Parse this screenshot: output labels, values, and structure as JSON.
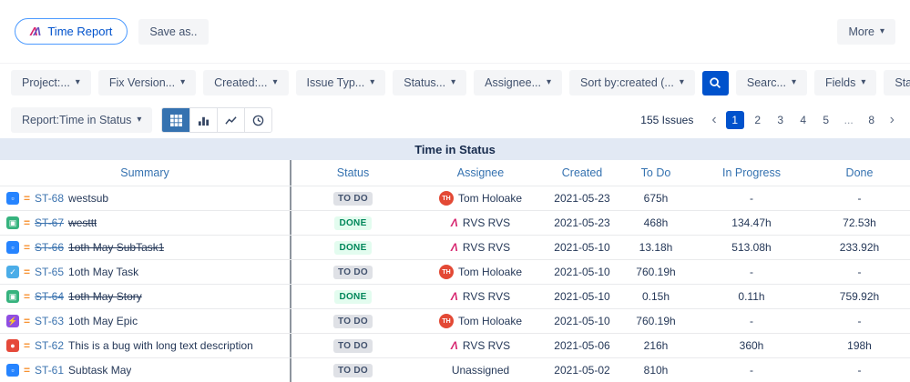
{
  "colors": {
    "accent_blue": "#0052cc",
    "header_link_blue": "#3572b0",
    "done_green": "#00875a",
    "todo_gray": "#42526e",
    "logo_red": "#d6246e",
    "logo_purple": "#6554c0",
    "priority_orange": "#f79232",
    "band_background": "#e2e9f4"
  },
  "icons": {
    "chevron_down": "▾",
    "rvs_logo": "Λ",
    "prev": "‹",
    "next": "›",
    "priority_medium": "=",
    "types": {
      "subtask": {
        "glyph": "▫",
        "color": "#2684ff"
      },
      "story": {
        "glyph": "▣",
        "color": "#36b37e"
      },
      "task": {
        "glyph": "✓",
        "color": "#4bade8"
      },
      "epic": {
        "glyph": "⚡",
        "color": "#904ee2"
      },
      "bug": {
        "glyph": "●",
        "color": "#e5493a"
      }
    }
  },
  "topbar": {
    "title_button": "Time Report",
    "save_as": "Save as..",
    "more": "More"
  },
  "filters": [
    "Project:...",
    "Fix Version...",
    "Created:...",
    "Issue Typ...",
    "Status...",
    "Assignee...",
    "Sort by:created (..."
  ],
  "toolbar_right": {
    "search": "Searc...",
    "fields": "Fields",
    "statuses": "Statuses"
  },
  "report_bar": {
    "report_select": "Report:Time in Status",
    "issues_count": "155 Issues",
    "pages": [
      "1",
      "2",
      "3",
      "4",
      "5",
      "...",
      "8"
    ],
    "active_page": "1"
  },
  "band_title": "Time in Status",
  "table": {
    "columns": [
      "Summary",
      "Status",
      "Assignee",
      "Created",
      "To Do",
      "In Progress",
      "Done"
    ],
    "rows": [
      {
        "key": "ST-68",
        "summary": "westsub",
        "type": "subtask",
        "struck": false,
        "status": "TO DO",
        "status_kind": "todo",
        "assignee": "Tom Holoake",
        "avatar": "TH",
        "avatar_kind": "initials",
        "created": "2021-05-23",
        "todo": "675h",
        "in_progress": "-",
        "done": "-"
      },
      {
        "key": "ST-67",
        "summary": "westtt",
        "type": "story",
        "struck": true,
        "status": "DONE",
        "status_kind": "done",
        "assignee": "RVS RVS",
        "avatar": "",
        "avatar_kind": "rvs",
        "created": "2021-05-23",
        "todo": "468h",
        "in_progress": "134.47h",
        "done": "72.53h"
      },
      {
        "key": "ST-66",
        "summary": "1oth May SubTask1",
        "type": "subtask",
        "struck": true,
        "status": "DONE",
        "status_kind": "done",
        "assignee": "RVS RVS",
        "avatar": "",
        "avatar_kind": "rvs",
        "created": "2021-05-10",
        "todo": "13.18h",
        "in_progress": "513.08h",
        "done": "233.92h"
      },
      {
        "key": "ST-65",
        "summary": "1oth May Task",
        "type": "task",
        "struck": false,
        "status": "TO DO",
        "status_kind": "todo",
        "assignee": "Tom Holoake",
        "avatar": "TH",
        "avatar_kind": "initials",
        "created": "2021-05-10",
        "todo": "760.19h",
        "in_progress": "-",
        "done": "-"
      },
      {
        "key": "ST-64",
        "summary": "1oth May Story",
        "type": "story",
        "struck": true,
        "status": "DONE",
        "status_kind": "done",
        "assignee": "RVS RVS",
        "avatar": "",
        "avatar_kind": "rvs",
        "created": "2021-05-10",
        "todo": "0.15h",
        "in_progress": "0.11h",
        "done": "759.92h"
      },
      {
        "key": "ST-63",
        "summary": "1oth May Epic",
        "type": "epic",
        "struck": false,
        "status": "TO DO",
        "status_kind": "todo",
        "assignee": "Tom Holoake",
        "avatar": "TH",
        "avatar_kind": "initials",
        "created": "2021-05-10",
        "todo": "760.19h",
        "in_progress": "-",
        "done": "-"
      },
      {
        "key": "ST-62",
        "summary": "This is a bug with long text description",
        "type": "bug",
        "struck": false,
        "status": "TO DO",
        "status_kind": "todo",
        "assignee": "RVS RVS",
        "avatar": "",
        "avatar_kind": "rvs",
        "created": "2021-05-06",
        "todo": "216h",
        "in_progress": "360h",
        "done": "198h"
      },
      {
        "key": "ST-61",
        "summary": "Subtask May",
        "type": "subtask",
        "struck": false,
        "status": "TO DO",
        "status_kind": "todo",
        "assignee": "Unassigned",
        "avatar": "",
        "avatar_kind": "none",
        "created": "2021-05-02",
        "todo": "810h",
        "in_progress": "-",
        "done": "-"
      }
    ]
  }
}
